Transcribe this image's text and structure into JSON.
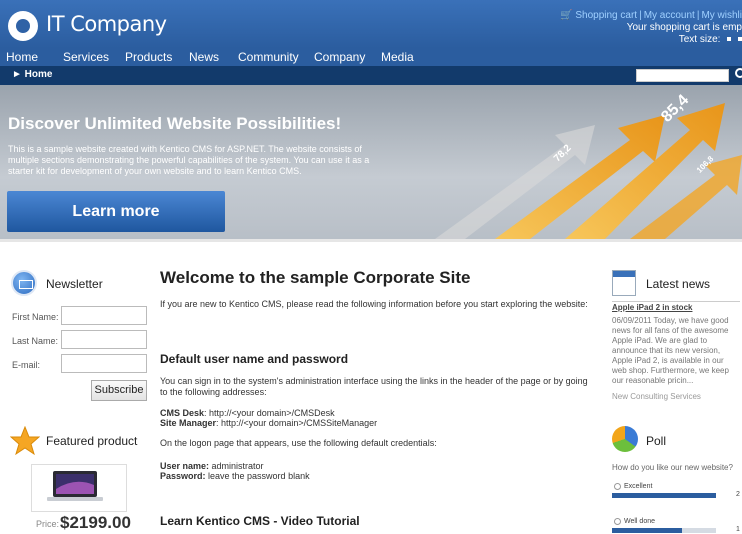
{
  "brand": {
    "name": "IT Company"
  },
  "top_links": {
    "cart": "Shopping cart",
    "account": "My account",
    "wishlist": "My wishli",
    "separator": "|"
  },
  "cart_status": "Your shopping cart is emp",
  "text_size": "Text size:",
  "menu": [
    "Home",
    "Services",
    "Products",
    "News",
    "Community",
    "Company",
    "Media"
  ],
  "menu_active": 0,
  "breadcrumb": "► Home",
  "search": {
    "value": ""
  },
  "banner": {
    "title": "Discover Unlimited Website Possibilities!",
    "text": "This is a sample website created with Kentico CMS for ASP.NET. The website consists of multiple sections demonstrating the powerful capabilities of the system. You can use it as a starter kit for development of your own website and to learn Kentico CMS.",
    "button": "Learn more",
    "chart_labels": [
      "85,4",
      "78,2",
      "106,8"
    ]
  },
  "newsletter": {
    "title": "Newsletter",
    "first_name_label": "First Name:",
    "last_name_label": "Last Name:",
    "email_label": "E-mail:",
    "subscribe": "Subscribe"
  },
  "featured": {
    "title": "Featured product",
    "price_label": "Price:",
    "price": "$2199.00"
  },
  "main": {
    "title": "Welcome to the sample Corporate Site",
    "intro": "If you are new to Kentico CMS, please read the following information before you start exploring the website:",
    "h_default": "Default user name and password",
    "signin": "You can sign in to the system's administration interface using the links in the header of the page or by going to the following addresses:",
    "cms_desk_label": "CMS Desk",
    "cms_desk_url": ": http://<your domain>/CMSDesk",
    "site_manager_label": "Site Manager",
    "site_manager_url": ": http://<your domain>/CMSSiteManager",
    "logon": "On the logon page that appears, use the following default credentials:",
    "user_label": "User name:",
    "user_value": " administrator",
    "password_label": "Password:",
    "password_value": " leave the password blank",
    "h_video": "Learn Kentico CMS - Video Tutorial"
  },
  "news": {
    "title": "Latest news",
    "head": "Apple iPad 2 in stock",
    "text": "06/09/2011 Today, we have good news for all fans of the awesome Apple iPad. We are glad to announce that its new version, Apple iPad 2, is available in our web shop. Furthermore, we keep our reasonable pricin...",
    "next": "New Consulting Services"
  },
  "poll": {
    "title": "Poll",
    "question": "How do you like our new website?",
    "answers": [
      {
        "label": "Excellent",
        "pct": "2",
        "fraction": 1.0
      },
      {
        "label": "Well done",
        "pct": "1",
        "fraction": 0.67
      }
    ]
  },
  "colors": {
    "header": "#2b5d9f",
    "crumb_bar": "#123a6b",
    "menu_active": "#9fd0ff",
    "accent_button": "#1f579f"
  }
}
